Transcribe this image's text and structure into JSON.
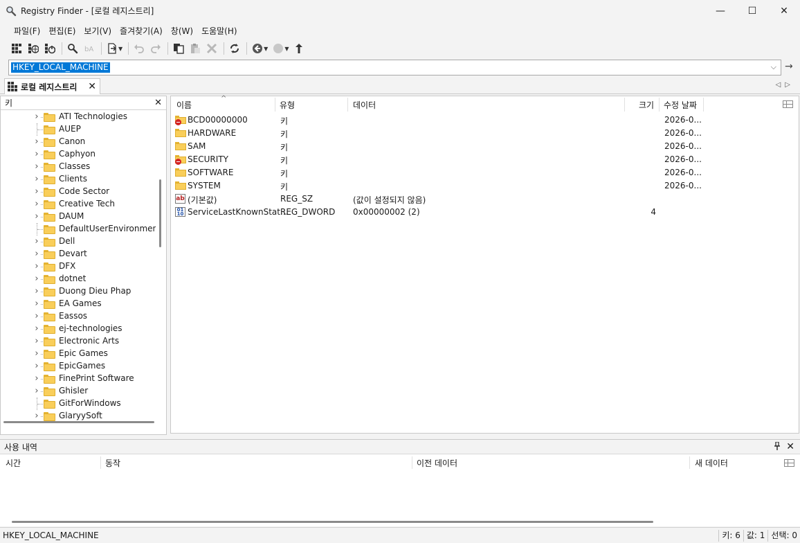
{
  "window": {
    "title": "Registry Finder - [로컬 레지스트리]",
    "minimize_glyph": "—",
    "maximize_glyph": "☐",
    "close_glyph": "✕"
  },
  "menu": [
    "파일(F)",
    "편집(E)",
    "보기(V)",
    "즐겨찾기(A)",
    "창(W)",
    "도움말(H)"
  ],
  "toolbar": {
    "icons": [
      "new-local-registry-icon",
      "remote-registry-icon",
      "registry-file-icon",
      "find-icon",
      "replace-icon",
      "export-icon",
      "undo-icon",
      "redo-icon",
      "copy-icon",
      "paste-icon",
      "delete-icon",
      "refresh-icon",
      "back-icon",
      "forward-icon",
      "up-icon"
    ]
  },
  "address": {
    "value": "HKEY_LOCAL_MACHINE"
  },
  "tab": {
    "label": "로컬 레지스트리"
  },
  "left_panel": {
    "header": "키",
    "items": [
      "ATI Technologies",
      "AUEP",
      "Canon",
      "Caphyon",
      "Classes",
      "Clients",
      "Code Sector",
      "Creative Tech",
      "DAUM",
      "DefaultUserEnvironment",
      "Dell",
      "Devart",
      "DFX",
      "dotnet",
      "Duong Dieu Phap",
      "EA Games",
      "Eassos",
      "ej-technologies",
      "Electronic Arts",
      "Epic Games",
      "EpicGames",
      "FinePrint Software",
      "Ghisler",
      "GitForWindows",
      "GlaryySoft"
    ],
    "expandable": [
      true,
      false,
      true,
      true,
      true,
      true,
      true,
      true,
      true,
      false,
      true,
      true,
      true,
      true,
      true,
      true,
      true,
      true,
      true,
      true,
      true,
      true,
      true,
      false,
      true
    ]
  },
  "right_panel": {
    "columns": {
      "name": "이름",
      "type": "유형",
      "data": "데이터",
      "size": "크기",
      "modified": "수정 날짜"
    },
    "rows": [
      {
        "icon": "folder-restricted",
        "name": "BCD00000000",
        "type": "키",
        "data": "",
        "size": "",
        "modified": "2026-0..."
      },
      {
        "icon": "folder",
        "name": "HARDWARE",
        "type": "키",
        "data": "",
        "size": "",
        "modified": "2026-0..."
      },
      {
        "icon": "folder",
        "name": "SAM",
        "type": "키",
        "data": "",
        "size": "",
        "modified": "2026-0..."
      },
      {
        "icon": "folder-restricted",
        "name": "SECURITY",
        "type": "키",
        "data": "",
        "size": "",
        "modified": "2026-0..."
      },
      {
        "icon": "folder",
        "name": "SOFTWARE",
        "type": "키",
        "data": "",
        "size": "",
        "modified": "2026-0..."
      },
      {
        "icon": "folder",
        "name": "SYSTEM",
        "type": "키",
        "data": "",
        "size": "",
        "modified": "2026-0..."
      },
      {
        "icon": "string-value",
        "name": "(기본값)",
        "type": "REG_SZ",
        "data": "(값이 설정되지 않음)",
        "size": "",
        "modified": ""
      },
      {
        "icon": "binary-value",
        "name": "ServiceLastKnownStat...",
        "type": "REG_DWORD",
        "data": "0x00000002 (2)",
        "size": "4",
        "modified": ""
      }
    ]
  },
  "history_panel": {
    "title": "사용 내역",
    "columns": {
      "time": "시간",
      "action": "동작",
      "old_data": "이전 데이터",
      "new_data": "새 데이터"
    }
  },
  "statusbar": {
    "path": "HKEY_LOCAL_MACHINE",
    "keys": "키: 6",
    "values": "값: 1",
    "selected": "선택: 0"
  },
  "colors": {
    "selection": "#0078d7",
    "folder": "#f9ce5a",
    "restricted": "#d42424"
  }
}
